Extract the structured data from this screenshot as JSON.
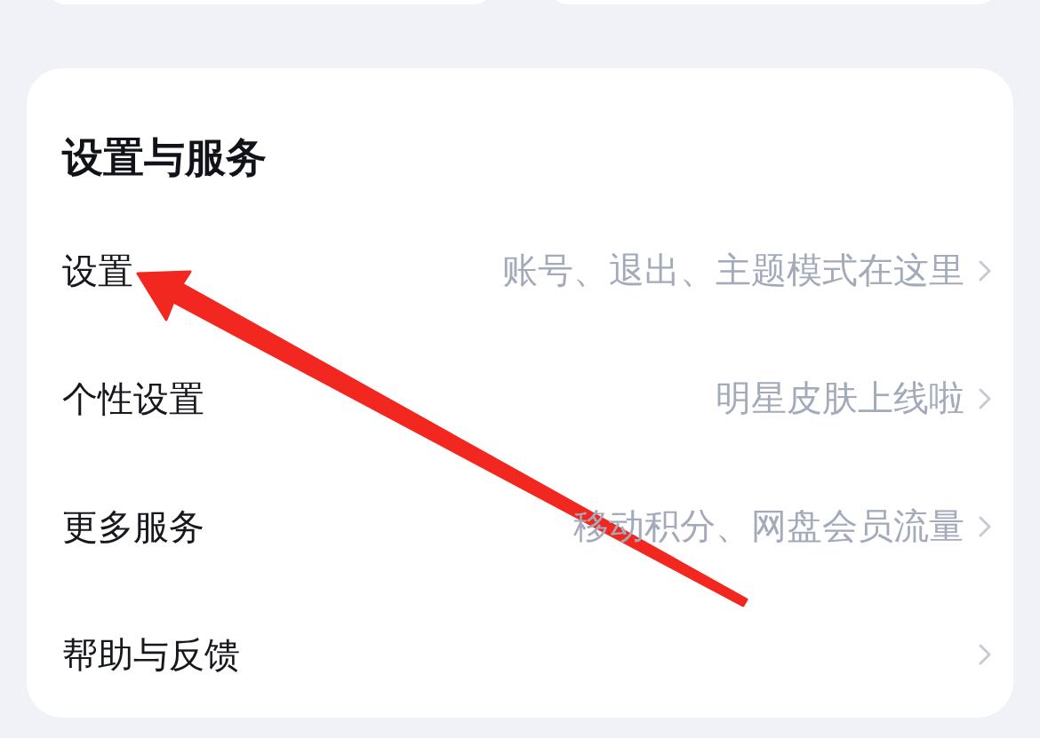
{
  "section": {
    "title": "设置与服务",
    "items": [
      {
        "label": "设置",
        "detail": "账号、退出、主题模式在这里"
      },
      {
        "label": "个性设置",
        "detail": "明星皮肤上线啦"
      },
      {
        "label": "更多服务",
        "detail": "移动积分、网盘会员流量"
      },
      {
        "label": "帮助与反馈"
      }
    ]
  }
}
